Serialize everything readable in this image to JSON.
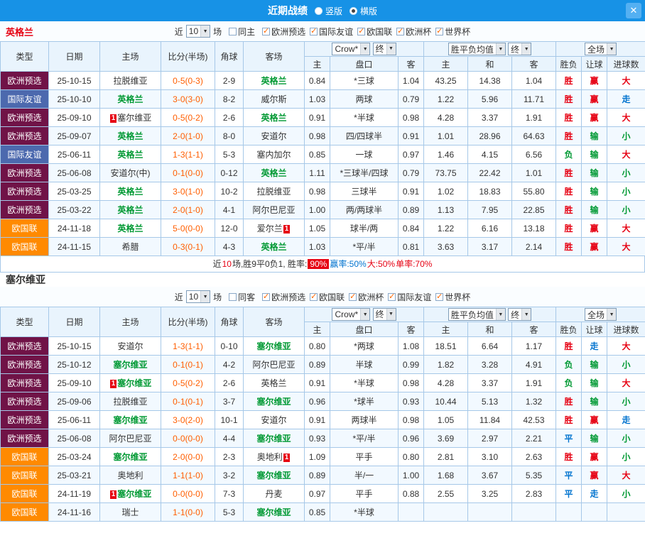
{
  "titlebar": {
    "title": "近期战绩",
    "radio_vertical": "竖版",
    "radio_horizontal": "横版"
  },
  "icons": {
    "dropdown_arrow": "▼",
    "close": "✕",
    "check": "✓"
  },
  "card_badge": "1",
  "header_labels": {
    "near": "近",
    "matches_select": "10",
    "games": "场",
    "odds_select": "Crow*",
    "final_select": "终",
    "europe_select": "胜平负均值",
    "scope_select": "全场",
    "col_type": "类型",
    "col_date": "日期",
    "col_home": "主场",
    "col_score": "比分(半场)",
    "col_corner": "角球",
    "col_away": "客场",
    "col_host": "主",
    "col_handicap": "盘口",
    "col_guest": "客",
    "col_host2": "主",
    "col_draw": "和",
    "col_guest2": "客",
    "col_result": "胜负",
    "col_let": "让球",
    "col_goals": "进球数"
  },
  "type_colors": {
    "欧洲预选": "#701347",
    "国际友谊": "#4C69AE",
    "欧国联": "#FF8A00"
  },
  "result_colors": {
    "胜": "#E60012",
    "负": "#009933",
    "平": "#0073CF",
    "赢": "#E60012",
    "输": "#009933",
    "走": "#0073CF",
    "大": "#E60012",
    "小": "#009933"
  },
  "sections": [
    {
      "team": "英格兰",
      "team_color": "#E60012",
      "same_label": "同主",
      "leagues": [
        "欧洲预选",
        "国际友谊",
        "欧国联",
        "欧洲杯",
        "世界杯"
      ],
      "rows": [
        {
          "type": "欧洲预选",
          "date": "25-10-15",
          "home": {
            "name": "拉脱维亚",
            "focus": false,
            "card": ""
          },
          "score": "0-5(0-3)",
          "corner": "2-9",
          "away": {
            "name": "英格兰",
            "focus": true,
            "card": ""
          },
          "w1": "0.84",
          "handicap": "*三球",
          "w2": "1.04",
          "e1": "43.25",
          "e2": "14.38",
          "e3": "1.04",
          "res": "胜",
          "let": "赢",
          "goal": "大"
        },
        {
          "type": "国际友谊",
          "date": "25-10-10",
          "home": {
            "name": "英格兰",
            "focus": true,
            "card": ""
          },
          "score": "3-0(3-0)",
          "corner": "8-2",
          "away": {
            "name": "威尔斯",
            "focus": false,
            "card": ""
          },
          "w1": "1.03",
          "handicap": "两球",
          "w2": "0.79",
          "e1": "1.22",
          "e2": "5.96",
          "e3": "11.71",
          "res": "胜",
          "let": "赢",
          "goal": "走"
        },
        {
          "type": "欧洲预选",
          "date": "25-09-10",
          "home": {
            "name": "塞尔维亚",
            "focus": false,
            "card": "pre"
          },
          "score": "0-5(0-2)",
          "corner": "2-6",
          "away": {
            "name": "英格兰",
            "focus": true,
            "card": ""
          },
          "w1": "0.91",
          "handicap": "*半球",
          "w2": "0.98",
          "e1": "4.28",
          "e2": "3.37",
          "e3": "1.91",
          "res": "胜",
          "let": "赢",
          "goal": "大"
        },
        {
          "type": "欧洲预选",
          "date": "25-09-07",
          "home": {
            "name": "英格兰",
            "focus": true,
            "card": ""
          },
          "score": "2-0(1-0)",
          "corner": "8-0",
          "away": {
            "name": "安道尔",
            "focus": false,
            "card": ""
          },
          "w1": "0.98",
          "handicap": "四/四球半",
          "w2": "0.91",
          "e1": "1.01",
          "e2": "28.96",
          "e3": "64.63",
          "res": "胜",
          "let": "输",
          "goal": "小"
        },
        {
          "type": "国际友谊",
          "date": "25-06-11",
          "home": {
            "name": "英格兰",
            "focus": true,
            "card": ""
          },
          "score": "1-3(1-1)",
          "corner": "5-3",
          "away": {
            "name": "塞内加尔",
            "focus": false,
            "card": ""
          },
          "w1": "0.85",
          "handicap": "一球",
          "w2": "0.97",
          "e1": "1.46",
          "e2": "4.15",
          "e3": "6.56",
          "res": "负",
          "let": "输",
          "goal": "大"
        },
        {
          "type": "欧洲预选",
          "date": "25-06-08",
          "home": {
            "name": "安道尔(中)",
            "focus": false,
            "card": ""
          },
          "score": "0-1(0-0)",
          "corner": "0-12",
          "away": {
            "name": "英格兰",
            "focus": true,
            "card": ""
          },
          "w1": "1.11",
          "handicap": "*三球半/四球",
          "w2": "0.79",
          "e1": "73.75",
          "e2": "22.42",
          "e3": "1.01",
          "res": "胜",
          "let": "输",
          "goal": "小"
        },
        {
          "type": "欧洲预选",
          "date": "25-03-25",
          "home": {
            "name": "英格兰",
            "focus": true,
            "card": ""
          },
          "score": "3-0(1-0)",
          "corner": "10-2",
          "away": {
            "name": "拉脱维亚",
            "focus": false,
            "card": ""
          },
          "w1": "0.98",
          "handicap": "三球半",
          "w2": "0.91",
          "e1": "1.02",
          "e2": "18.83",
          "e3": "55.80",
          "res": "胜",
          "let": "输",
          "goal": "小"
        },
        {
          "type": "欧洲预选",
          "date": "25-03-22",
          "home": {
            "name": "英格兰",
            "focus": true,
            "card": ""
          },
          "score": "2-0(1-0)",
          "corner": "4-1",
          "away": {
            "name": "阿尔巴尼亚",
            "focus": false,
            "card": ""
          },
          "w1": "1.00",
          "handicap": "两/两球半",
          "w2": "0.89",
          "e1": "1.13",
          "e2": "7.95",
          "e3": "22.85",
          "res": "胜",
          "let": "输",
          "goal": "小"
        },
        {
          "type": "欧国联",
          "date": "24-11-18",
          "home": {
            "name": "英格兰",
            "focus": true,
            "card": ""
          },
          "score": "5-0(0-0)",
          "corner": "12-0",
          "away": {
            "name": "爱尔兰",
            "focus": false,
            "card": "post"
          },
          "w1": "1.05",
          "handicap": "球半/两",
          "w2": "0.84",
          "e1": "1.22",
          "e2": "6.16",
          "e3": "13.18",
          "res": "胜",
          "let": "赢",
          "goal": "大"
        },
        {
          "type": "欧国联",
          "date": "24-11-15",
          "home": {
            "name": "希腊",
            "focus": false,
            "card": ""
          },
          "score": "0-3(0-1)",
          "corner": "4-3",
          "away": {
            "name": "英格兰",
            "focus": true,
            "card": ""
          },
          "w1": "1.03",
          "handicap": "*平/半",
          "w2": "0.81",
          "e1": "3.63",
          "e2": "3.17",
          "e3": "2.14",
          "res": "胜",
          "let": "赢",
          "goal": "大"
        }
      ],
      "summary": {
        "parts": [
          {
            "text": "近",
            "color": "#333333"
          },
          {
            "text": "10",
            "color": "#E60012"
          },
          {
            "text": "场,胜9平0负1, 胜率: ",
            "color": "#333333"
          },
          {
            "text": "90%",
            "color": "#FFFFFF",
            "bg": "#E60012"
          },
          {
            "text": " 赢率:50%",
            "color": "#0073CF"
          },
          {
            "text": " 大:50%",
            "color": "#E60012"
          },
          {
            "text": " 单率:70%",
            "color": "#E60012"
          }
        ]
      }
    },
    {
      "team": "塞尔维亚",
      "team_color": "#333333",
      "same_label": "同客",
      "leagues": [
        "欧洲预选",
        "欧国联",
        "欧洲杯",
        "国际友谊",
        "世界杯"
      ],
      "rows": [
        {
          "type": "欧洲预选",
          "date": "25-10-15",
          "home": {
            "name": "安道尔",
            "focus": false,
            "card": ""
          },
          "score": "1-3(1-1)",
          "corner": "0-10",
          "away": {
            "name": "塞尔维亚",
            "focus": true,
            "card": ""
          },
          "w1": "0.80",
          "handicap": "*两球",
          "w2": "1.08",
          "e1": "18.51",
          "e2": "6.64",
          "e3": "1.17",
          "res": "胜",
          "let": "走",
          "goal": "大"
        },
        {
          "type": "欧洲预选",
          "date": "25-10-12",
          "home": {
            "name": "塞尔维亚",
            "focus": true,
            "card": ""
          },
          "score": "0-1(0-1)",
          "corner": "4-2",
          "away": {
            "name": "阿尔巴尼亚",
            "focus": false,
            "card": ""
          },
          "w1": "0.89",
          "handicap": "半球",
          "w2": "0.99",
          "e1": "1.82",
          "e2": "3.28",
          "e3": "4.91",
          "res": "负",
          "let": "输",
          "goal": "小"
        },
        {
          "type": "欧洲预选",
          "date": "25-09-10",
          "home": {
            "name": "塞尔维亚",
            "focus": true,
            "card": "pre"
          },
          "score": "0-5(0-2)",
          "corner": "2-6",
          "away": {
            "name": "英格兰",
            "focus": false,
            "card": ""
          },
          "w1": "0.91",
          "handicap": "*半球",
          "w2": "0.98",
          "e1": "4.28",
          "e2": "3.37",
          "e3": "1.91",
          "res": "负",
          "let": "输",
          "goal": "大"
        },
        {
          "type": "欧洲预选",
          "date": "25-09-06",
          "home": {
            "name": "拉脱维亚",
            "focus": false,
            "card": ""
          },
          "score": "0-1(0-1)",
          "corner": "3-7",
          "away": {
            "name": "塞尔维亚",
            "focus": true,
            "card": ""
          },
          "w1": "0.96",
          "handicap": "*球半",
          "w2": "0.93",
          "e1": "10.44",
          "e2": "5.13",
          "e3": "1.32",
          "res": "胜",
          "let": "输",
          "goal": "小"
        },
        {
          "type": "欧洲预选",
          "date": "25-06-11",
          "home": {
            "name": "塞尔维亚",
            "focus": true,
            "card": ""
          },
          "score": "3-0(2-0)",
          "corner": "10-1",
          "away": {
            "name": "安道尔",
            "focus": false,
            "card": ""
          },
          "w1": "0.91",
          "handicap": "两球半",
          "w2": "0.98",
          "e1": "1.05",
          "e2": "11.84",
          "e3": "42.53",
          "res": "胜",
          "let": "赢",
          "goal": "走"
        },
        {
          "type": "欧洲预选",
          "date": "25-06-08",
          "home": {
            "name": "阿尔巴尼亚",
            "focus": false,
            "card": ""
          },
          "score": "0-0(0-0)",
          "corner": "4-4",
          "away": {
            "name": "塞尔维亚",
            "focus": true,
            "card": ""
          },
          "w1": "0.93",
          "handicap": "*平/半",
          "w2": "0.96",
          "e1": "3.69",
          "e2": "2.97",
          "e3": "2.21",
          "res": "平",
          "let": "输",
          "goal": "小"
        },
        {
          "type": "欧国联",
          "date": "25-03-24",
          "home": {
            "name": "塞尔维亚",
            "focus": true,
            "card": ""
          },
          "score": "2-0(0-0)",
          "corner": "2-3",
          "away": {
            "name": "奥地利",
            "focus": false,
            "card": "post"
          },
          "w1": "1.09",
          "handicap": "平手",
          "w2": "0.80",
          "e1": "2.81",
          "e2": "3.10",
          "e3": "2.63",
          "res": "胜",
          "let": "赢",
          "goal": "小"
        },
        {
          "type": "欧国联",
          "date": "25-03-21",
          "home": {
            "name": "奥地利",
            "focus": false,
            "card": ""
          },
          "score": "1-1(1-0)",
          "corner": "3-2",
          "away": {
            "name": "塞尔维亚",
            "focus": true,
            "card": ""
          },
          "w1": "0.89",
          "handicap": "半/一",
          "w2": "1.00",
          "e1": "1.68",
          "e2": "3.67",
          "e3": "5.35",
          "res": "平",
          "let": "赢",
          "goal": "大"
        },
        {
          "type": "欧国联",
          "date": "24-11-19",
          "home": {
            "name": "塞尔维亚",
            "focus": true,
            "card": "pre"
          },
          "score": "0-0(0-0)",
          "corner": "7-3",
          "away": {
            "name": "丹麦",
            "focus": false,
            "card": ""
          },
          "w1": "0.97",
          "handicap": "平手",
          "w2": "0.88",
          "e1": "2.55",
          "e2": "3.25",
          "e3": "2.83",
          "res": "平",
          "let": "走",
          "goal": "小"
        },
        {
          "type": "欧国联",
          "date": "24-11-16",
          "home": {
            "name": "瑞士",
            "focus": false,
            "card": ""
          },
          "score": "1-1(0-0)",
          "corner": "5-3",
          "away": {
            "name": "塞尔维亚",
            "focus": true,
            "card": ""
          },
          "w1": "0.85",
          "handicap": "*半球",
          "w2": "",
          "e1": "",
          "e2": "",
          "e3": "",
          "res": "",
          "let": "",
          "goal": ""
        }
      ],
      "summary": null
    }
  ]
}
